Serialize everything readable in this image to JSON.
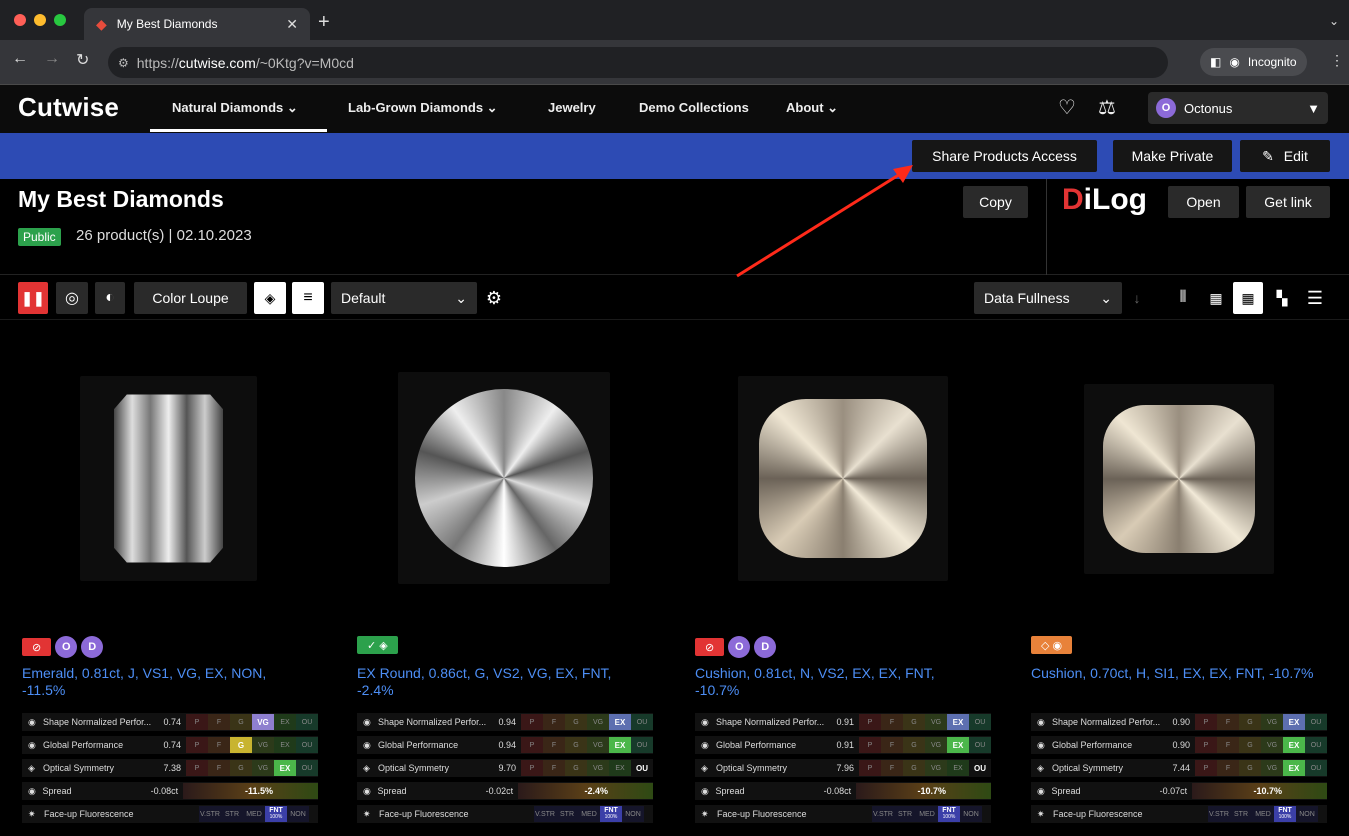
{
  "browser": {
    "tab_title": "My Best Diamonds",
    "url_prefix": "https://",
    "url_host": "cutwise.com",
    "url_path": "/~0Ktg?v=M0cd",
    "incognito_label": "Incognito"
  },
  "site": {
    "logo": "Cutwise",
    "nav": [
      "Natural Diamonds",
      "Lab-Grown Diamonds",
      "Jewelry",
      "Demo Collections",
      "About"
    ],
    "user": {
      "initial": "O",
      "name": "Octonus"
    }
  },
  "actionbar": {
    "share": "Share Products Access",
    "private": "Make Private",
    "edit": "Edit"
  },
  "collection": {
    "title": "My Best Diamonds",
    "badge": "Public",
    "meta": "26 product(s) | 02.10.2023",
    "copy": "Copy",
    "open": "Open",
    "get_link": "Get link"
  },
  "dilog": {
    "d": "D",
    "rest": "iLog"
  },
  "toolbar": {
    "color_loupe": "Color Loupe",
    "sort_default": "Default",
    "data_fullness": "Data Fullness"
  },
  "metric_labels": [
    "Shape Normalized Perfor...",
    "Global Performance",
    "Optical Symmetry",
    "Spread",
    "Face-up Fluorescence"
  ],
  "scale_labels": [
    "P",
    "F",
    "G",
    "VG",
    "EX",
    "OU"
  ],
  "fluor_labels": [
    "V.STR",
    "STR",
    "MED",
    "FNT",
    "NON"
  ],
  "products": [
    {
      "title": "Emerald, 0.81ct, J, VS1, VG, EX, NON, -11.5%",
      "values": [
        "0.74",
        "0.74",
        "7.38",
        "-0.08ct"
      ],
      "spread": "-11.5%",
      "highlight": [
        "VG",
        "G",
        "EX"
      ],
      "badge_color": "#e23434",
      "badge_text": "⊘",
      "circles": [
        "O",
        "D"
      ],
      "gem": "emerald"
    },
    {
      "title": "EX Round, 0.86ct, G, VS2, VG, EX, FNT, -2.4%",
      "values": [
        "0.94",
        "0.94",
        "9.70",
        "-0.02ct"
      ],
      "spread": "-2.4%",
      "highlight": [
        "EX",
        "EX",
        "OU"
      ],
      "badge_color": "#2ca14c",
      "badge_text": "✓ ◈",
      "circles": [],
      "gem": "round"
    },
    {
      "title": "Cushion, 0.81ct, N, VS2, EX, EX, FNT, -10.7%",
      "values": [
        "0.91",
        "0.91",
        "7.96",
        "-0.08ct"
      ],
      "spread": "-10.7%",
      "highlight": [
        "EX",
        "EX",
        "OU"
      ],
      "badge_color": "#e23434",
      "badge_text": "⊘",
      "circles": [
        "O",
        "D"
      ],
      "gem": "cushion"
    },
    {
      "title": "Cushion, 0.70ct, H, SI1, EX, EX, FNT, -10.7%",
      "values": [
        "0.90",
        "0.90",
        "7.44",
        "-0.07ct"
      ],
      "spread": "-10.7%",
      "highlight": [
        "EX",
        "EX",
        "EX"
      ],
      "badge_color": "#e8823a",
      "badge_text": "◇ ◉",
      "circles": [],
      "gem": "cushion2"
    }
  ],
  "fluor_active": "FNT",
  "fluor_pct": "100%"
}
